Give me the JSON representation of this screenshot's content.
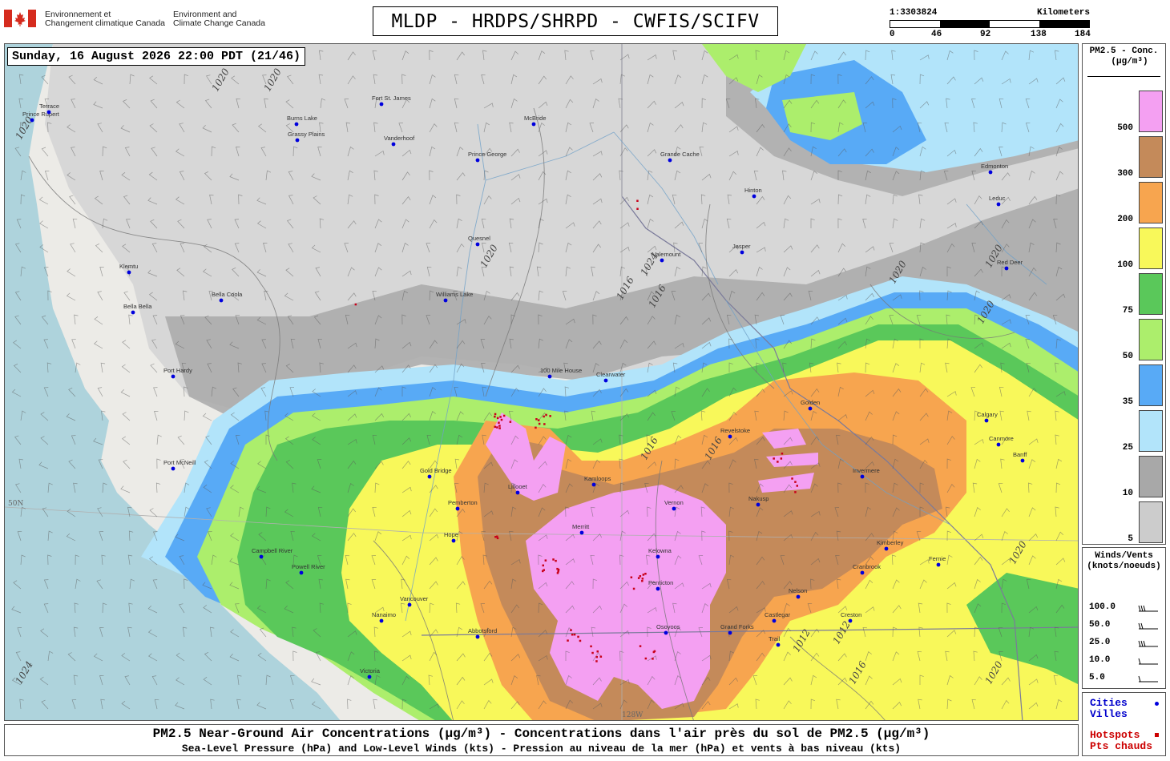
{
  "header": {
    "agency_fr": [
      "Environnement et",
      "Changement climatique Canada"
    ],
    "agency_en": [
      "Environment and",
      "Climate Change Canada"
    ],
    "title": "MLDP - HRDPS/SHRPD - CWFIS/SCIFV"
  },
  "scale": {
    "ratio": "1:3303824",
    "units": "Kilometers",
    "ticks": [
      "0",
      "46",
      "92",
      "138",
      "184"
    ]
  },
  "timestamp": "Sunday, 16 August 2026 22:00 PDT (21/46)",
  "legend": {
    "title_line1": "PM2.5 - Conc.",
    "title_line2": "(μg/m³)",
    "bins": [
      {
        "label": "500",
        "color": "#f4a0f2"
      },
      {
        "label": "300",
        "color": "#c48a5a"
      },
      {
        "label": "200",
        "color": "#f7a54f"
      },
      {
        "label": "100",
        "color": "#f8f85a"
      },
      {
        "label": "75",
        "color": "#5ac85a"
      },
      {
        "label": "50",
        "color": "#acee6c"
      },
      {
        "label": "35",
        "color": "#58aaf6"
      },
      {
        "label": "25",
        "color": "#b2e4fa"
      },
      {
        "label": "10",
        "color": "#a8a8a8"
      },
      {
        "label": "5",
        "color": "#cccccc"
      }
    ]
  },
  "winds": {
    "title_line1": "Winds/Vents",
    "title_line2": "(knots/noeuds)",
    "rows": [
      "100.0",
      "50.0",
      "25.0",
      "10.0",
      "5.0"
    ]
  },
  "points": {
    "cities_en": "Cities",
    "cities_fr": "Villes",
    "hotspots_en": "Hotspots",
    "hotspots_fr": "Pts chauds"
  },
  "caption": {
    "line1": "PM2.5 Near-Ground Air Concentrations (μg/m³) - Concentrations dans l'air près du sol de PM2.5 (μg/m³)",
    "line2": "Sea-Level Pressure (hPa) and Low-Level Winds (kts) - Pression au niveau de la mer (hPa) et vents à bas niveau (kts)"
  },
  "map": {
    "cities": [
      "Prince Rupert",
      "Terrace",
      "Burns Lake",
      "Fort St. James",
      "Vanderhoof",
      "Grassy Plains",
      "Prince George",
      "McBride",
      "Grande Cache",
      "Hinton",
      "Edmonton",
      "Leduc",
      "Red Deer",
      "Calgary",
      "Jasper",
      "Valemount",
      "Quesnel",
      "Williams Lake",
      "100 Mile House",
      "Clearwater",
      "Bella Coola",
      "Bella Bella",
      "Klemtu",
      "Port Hardy",
      "Port McNeill",
      "Campbell River",
      "Powell River",
      "Gold Bridge",
      "Lillooet",
      "Pemberton",
      "Kamloops",
      "Revelstoke",
      "Golden",
      "Invermere",
      "Nakusp",
      "Vernon",
      "Kelowna",
      "Penticton",
      "Merritt",
      "Vancouver",
      "Nanaimo",
      "Victoria",
      "Nelson",
      "Cranbrook",
      "Fernie",
      "Grand Forks",
      "Osoyoos",
      "Kimberley",
      "Banff",
      "Canmore",
      "Hope",
      "Abbotsford",
      "Castlegar",
      "Trail",
      "Creston"
    ],
    "isobar_labels": [
      "1020",
      "1020",
      "1020",
      "1020",
      "1024",
      "1016",
      "1016",
      "1016",
      "1016",
      "1012",
      "1012",
      "1020",
      "1020",
      "1020",
      "1020",
      "1024",
      "1016",
      "1020"
    ],
    "meridian_label": "128W",
    "parallel_label": "50N"
  }
}
